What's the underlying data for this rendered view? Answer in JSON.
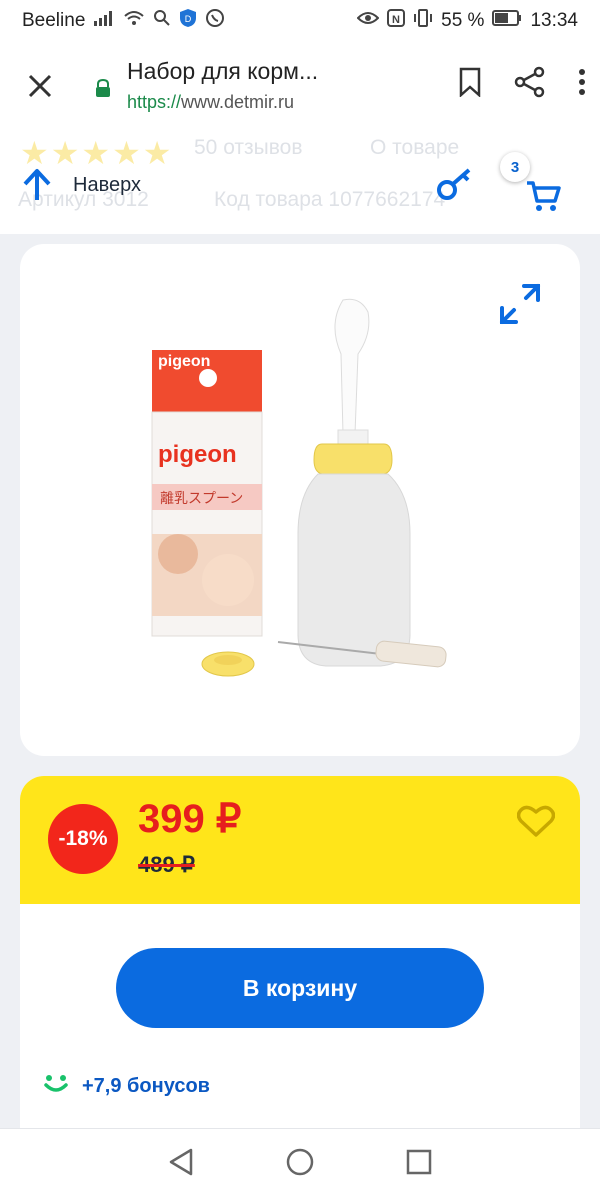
{
  "status_bar": {
    "carrier": "Beeline",
    "battery": "55 %",
    "time": "13:34"
  },
  "browser": {
    "page_title": "Набор для корм...",
    "url_scheme": "https://",
    "url_host": "www.detmir.ru",
    "icons": [
      "close-icon",
      "lock-icon",
      "bookmark-icon",
      "share-icon",
      "more-icon"
    ]
  },
  "sticky_bar": {
    "up_label": "Наверх",
    "cart_count": "3",
    "ghost_reviews": "50 отзывов",
    "ghost_about": "О товаре",
    "ghost_article": "Артикул 3012",
    "ghost_code": "Код товара 1077662174"
  },
  "product": {
    "image_alt": "Pigeon weaning spoon bottle set",
    "package_brand": "pigeon",
    "package_title": "離乳スプーン",
    "discount": "-18%",
    "price": "399 ₽",
    "old_price": "489 ₽",
    "add_to_cart": "В корзину",
    "bonus": "+7,9 бонусов"
  },
  "colors": {
    "accent_blue": "#0b6be0",
    "price_bg": "#ffe51a",
    "price_red": "#e61e1e",
    "bonus_green": "#19c26b"
  }
}
